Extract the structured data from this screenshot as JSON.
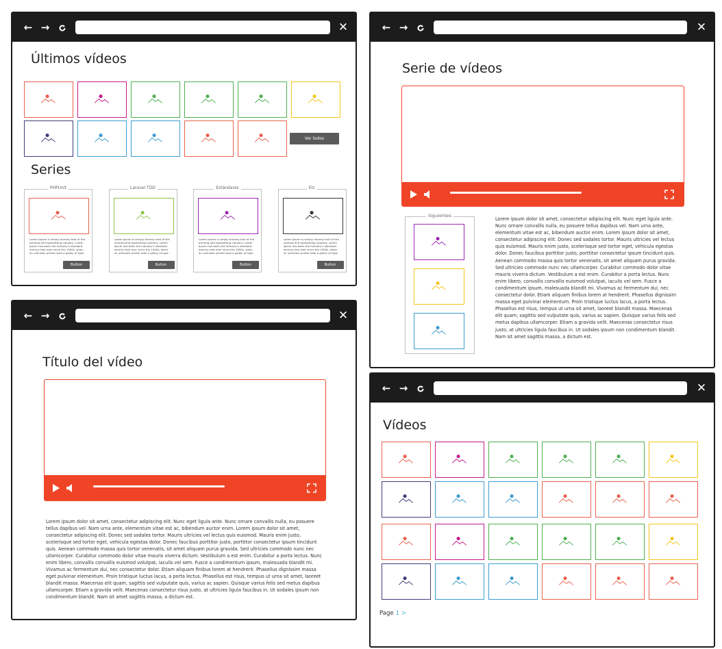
{
  "browser": {
    "back_icon": "arrow-left-icon",
    "forward_icon": "arrow-right-icon",
    "reload_icon": "reload-icon",
    "close_icon": "close-icon",
    "back": "←",
    "forward": "→",
    "close": "✕"
  },
  "home": {
    "latest_title": "Últimos vídeos",
    "latest_colors": [
      "#e8604c",
      "#c2188b",
      "#4caf50",
      "#4caf50",
      "#4caf50",
      "#f5c518",
      "#3d3d7a",
      "#3b9bd1",
      "#3b9bd1",
      "#e8604c",
      "#e8604c"
    ],
    "view_all": "Ver todos",
    "series_title": "Series",
    "series": [
      {
        "name": "PHPUnit",
        "color": "#e8604c",
        "text": "Lorem Ipsum is simply dummy text of the printing and typesetting industry. Lorem Ipsum has been the industry's standard dummy text ever since the 1500s, when an unknown printer took a galley of type and",
        "button": "Button"
      },
      {
        "name": "Laravel TDD",
        "color": "#8bc34a",
        "text": "Lorem Ipsum is simply dummy text of the printing and typesetting industry. Lorem Ipsum has been the industry's standard dummy text ever since the 1500s, when an unknown printer took a galley of type and",
        "button": "Button"
      },
      {
        "name": "Estándares",
        "color": "#9c27b0",
        "text": "Lorem Ipsum is simply dummy text of the printing and typesetting industry. Lorem Ipsum has been the industry's standard dummy text ever since the 1500s, when an unknown printer took a galley of type and",
        "button": "Button"
      },
      {
        "name": "Etc",
        "color": "#333333",
        "text": "Lorem Ipsum is simply dummy text of the printing and typesetting industry. Lorem Ipsum has been the industry's standard dummy text ever since the 1500s, when an unknown printer took a galley of type and",
        "button": "Button"
      }
    ]
  },
  "video_page": {
    "title": "Título del vídeo",
    "description": "Lorem ipsum dolor sit amet, consectetur adipiscing elit. Nunc eget ligula ante. Nunc ornare convallis nulla, eu posuere tellus dapibus vel. Nam urna ante, elementum vitae est ac, bibendum auctor enim. Lorem ipsum dolor sit amet, consectetur adipiscing elit. Donec sed sodales tortor. Mauris ultricies vel lectus quis euismod. Mauris enim justo, scelerisque sed tortor eget, vehicula egestas dolor. Donec faucibus porttitor justo, porttitor consectetur ipsum tincidunt quis. Aenean commodo massa quis tortor venenatis, sit amet aliquam purus gravida. Sed ultricies commodo nunc nec ullamcorper. Curabitur commodo dolor vitae mauris viverra dictum. Vestibulum a est enim. Curabitur a porta lectus. Nunc enim libero, convallis convallis euismod volutpat, iaculis vel sem. Fusce a condimentum ipsum, malesuada blandit mi. Vivamus ac fermentum dui, nec consectetur dolor. Etiam aliquam finibus lorem at hendrerit. Phasellus dignissim massa eget pulvinar elementum. Proin tristique luctus lacus, a porta lectus. Phasellus est risus, tempus ut urna sit amet, laoreet blandit massa. Maecenas elit quam, sagittis sed vulputate quis, varius ac sapien. Quisque varius felis sed metus dapibus ullamcorper. Etiam a gravida velit. Maecenas consectetur risus justo, at ultricies ligula faucibus in. Ut sodales ipsum non condimentum blandit. Nam sit amet sagittis massa, a dictum est.",
    "progress": 0.6,
    "accent": "#f04427"
  },
  "series_page": {
    "title": "Serie de vídeos",
    "next_label": "Siguientes",
    "next_colors": [
      "#9c27b0",
      "#f5c518",
      "#3b9bd1"
    ],
    "description": "Lorem ipsum dolor sit amet, consectetur adipiscing elit. Nunc eget ligula ante. Nunc ornare convallis nulla, eu posuere tellus dapibus vel. Nam urna ante, elementum vitae est ac, bibendum auctor enim. Lorem ipsum dolor sit amet, consectetur adipiscing elit. Donec sed sodales tortor. Mauris ultricies vel lectus quis euismod. Mauris enim justo, scelerisque sed tortor eget, vehicula egestas dolor. Donec faucibus porttitor justo, porttitor consectetur ipsum tincidunt quis. Aenean commodo massa quis tortor venenatis, sit amet aliquam purus gravida. Sed ultricies commodo nunc nec ullamcorper. Curabitur commodo dolor vitae mauris viverra dictum. Vestibulum a est enim. Curabitur a porta lectus. Nunc enim libero, convallis convallis euismod volutpat, iaculis vel sem. Fusce a condimentum ipsum, malesuada blandit mi. Vivamus ac fermentum dui, nec consectetur dolor. Etiam aliquam finibus lorem at hendrerit. Phasellus dignissim massa eget pulvinar elementum. Proin tristique luctus lacus, a porta lectus. Phasellus est risus, tempus ut urna sit amet, laoreet blandit massa. Maecenas elit quam, sagittis sed vulputate quis, varius ac sapien. Quisque varius felis sed metus dapibus ullamcorper. Etiam a gravida velit. Maecenas consectetur risus justo, at ultricies ligula faucibus in. Ut sodales ipsum non condimentum blandit. Nam sit amet sagittis massa, a dictum est.",
    "progress": 0.57
  },
  "videos_page": {
    "title": "Vídeos",
    "grid_colors": [
      [
        "#e8604c",
        "#c2188b",
        "#4caf50",
        "#4caf50",
        "#4caf50",
        "#f5c518"
      ],
      [
        "#3d3d7a",
        "#3b9bd1",
        "#3b9bd1",
        "#e8604c",
        "#e8604c",
        "#e8604c"
      ],
      [
        "#e8604c",
        "#c2188b",
        "#4caf50",
        "#4caf50",
        "#4caf50",
        "#f5c518"
      ],
      [
        "#3d3d7a",
        "#3b9bd1",
        "#3b9bd1",
        "#e8604c",
        "#e8604c",
        "#e8604c"
      ]
    ],
    "page_label": "Page",
    "page_number": "1",
    "page_next": ">"
  }
}
